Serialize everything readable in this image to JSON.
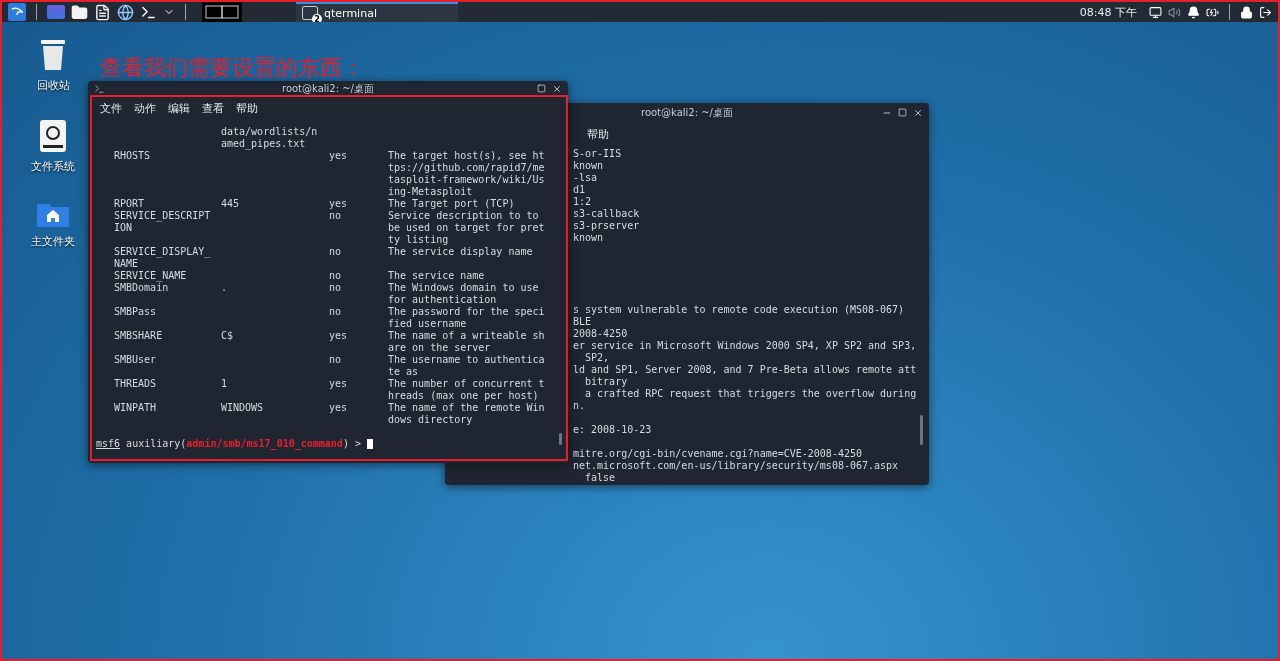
{
  "taskbar": {
    "launchers": [
      {
        "kind": "app"
      },
      {
        "kind": "folder"
      },
      {
        "kind": "file"
      },
      {
        "kind": "browser"
      },
      {
        "kind": "terminal"
      }
    ],
    "task": {
      "label": "qterminal",
      "badge": "2"
    },
    "clock": "08:48 下午"
  },
  "desktop_icons": [
    {
      "kind": "trash",
      "label": "回收站"
    },
    {
      "kind": "drive",
      "label": "文件系统"
    },
    {
      "kind": "home",
      "label": "主文件夹"
    }
  ],
  "back_window": {
    "title": "root@kali2: ~/桌面",
    "menu": [
      "帮助"
    ],
    "blocks": [
      [
        "S-or-IIS",
        "known",
        "-lsa",
        "d1",
        "1:2",
        "s3-callback",
        "s3-prserver",
        "known"
      ],
      [
        "s system vulnerable to remote code execution (MS08-067)",
        "BLE",
        "2008-4250",
        "er service in Microsoft Windows 2000 SP4, XP SP2 and SP3,",
        "  SP2,",
        "ld and SP1, Server 2008, and 7 Pre-Beta allows remote att",
        "  bitrary",
        "  a crafted RPC request that triggers the overflow during",
        "n."
      ],
      [
        "e: 2008-10-23"
      ],
      [
        "mitre.org/cgi-bin/cvename.cgi?name=CVE-2008-4250",
        "net.microsoft.com/en-us/library/security/ms08-067.aspx",
        "  false"
      ]
    ]
  },
  "annotation": "查看我们需要设置的东西：",
  "front_window": {
    "title": "root@kali2: ~/桌面",
    "menu": [
      "文件",
      "动作",
      "编辑",
      "查看",
      "帮助"
    ],
    "rows": [
      {
        "setting": "data/wordlists/n\named_pipes.txt"
      },
      {
        "name": "RHOSTS",
        "required": "yes",
        "description": "The target host(s), see ht\ntps://github.com/rapid7/me\ntasploit-framework/wiki/Us\ning-Metasploit"
      },
      {
        "name": "RPORT",
        "setting": "445",
        "required": "yes",
        "description": "The Target port (TCP)"
      },
      {
        "name": "SERVICE_DESCRIPT\nION",
        "required": "no",
        "description": "Service description to to\nbe used on target for pret\nty listing"
      },
      {
        "name": "SERVICE_DISPLAY_\nNAME",
        "required": "no",
        "description": "The service display name"
      },
      {
        "name": "SERVICE_NAME",
        "required": "no",
        "description": "The service name"
      },
      {
        "name": "SMBDomain",
        "setting": ".",
        "required": "no",
        "description": "The Windows domain to use\nfor authentication"
      },
      {
        "name": "SMBPass",
        "required": "no",
        "description": "The password for the speci\nfied username"
      },
      {
        "name": "SMBSHARE",
        "setting": "C$",
        "required": "yes",
        "description": "The name of a writeable sh\nare on the server"
      },
      {
        "name": "SMBUser",
        "required": "no",
        "description": "The username to authentica\nte as"
      },
      {
        "name": "THREADS",
        "setting": "1",
        "required": "yes",
        "description": "The number of concurrent t\nhreads (max one per host)"
      },
      {
        "name": "WINPATH",
        "setting": "WINDOWS",
        "required": "yes",
        "description": "The name of the remote Win\ndows directory"
      }
    ],
    "prompt": {
      "prefix": "msf6",
      "text": " auxiliary(",
      "module": "admin/smb/ms17_010_command",
      "suffix": ") >"
    }
  }
}
